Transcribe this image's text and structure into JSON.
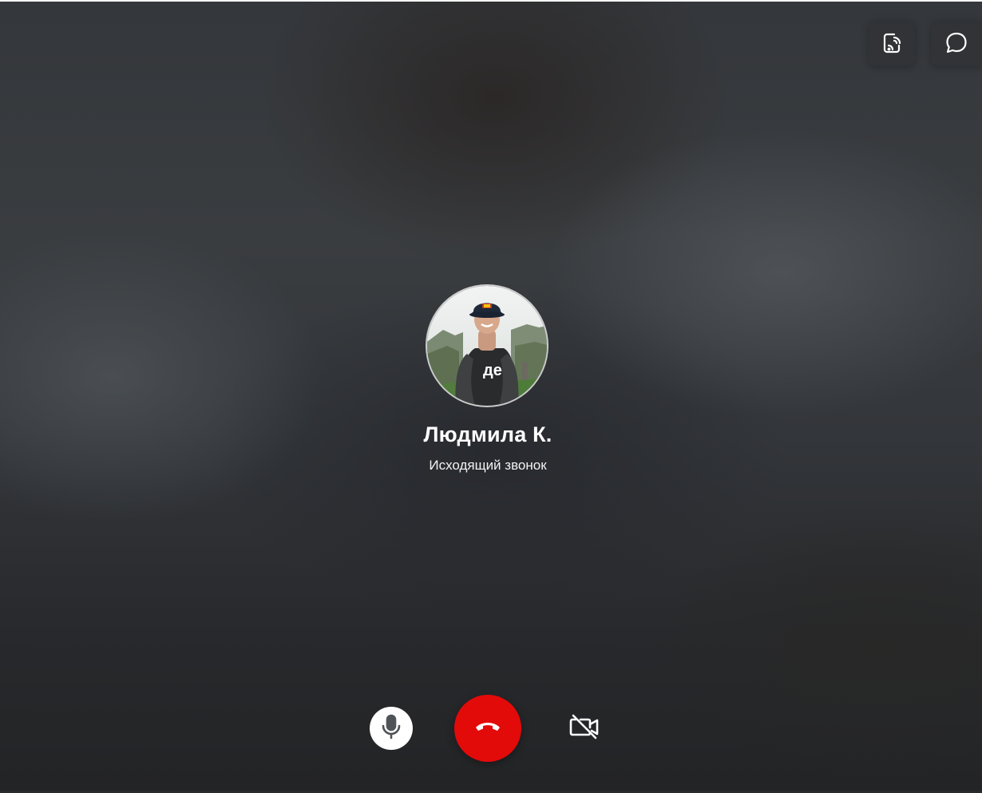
{
  "caller": {
    "name": "Людмила К.",
    "status": "Исходящий звонок"
  },
  "top_controls": [
    {
      "icon": "screen-share-icon"
    },
    {
      "icon": "chat-bubble-icon"
    }
  ],
  "call_controls": {
    "mic": {
      "icon": "microphone-icon",
      "state": "on"
    },
    "hangup": {
      "icon": "phone-hangup-icon",
      "color": "#e30a0a"
    },
    "video": {
      "icon": "video-off-icon",
      "state": "off"
    }
  },
  "avatar": {
    "icon": "user-avatar-photo"
  }
}
